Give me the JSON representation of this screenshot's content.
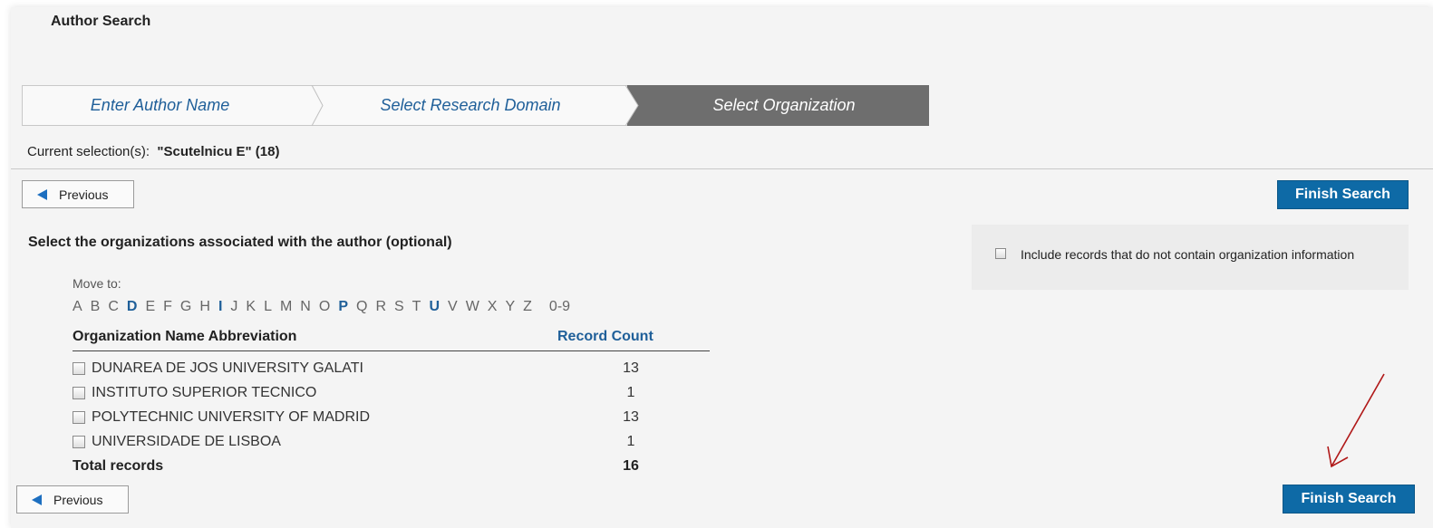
{
  "page": {
    "title": "Author Search"
  },
  "steps": [
    {
      "label": "Enter Author Name",
      "active": false
    },
    {
      "label": "Select Research Domain",
      "active": false
    },
    {
      "label": "Select Organization",
      "active": true
    }
  ],
  "selection": {
    "prefix": "Current selection(s):",
    "value": "\"Scutelnicu E\" (18)"
  },
  "buttons": {
    "previous": "Previous",
    "finish": "Finish Search"
  },
  "org_section": {
    "heading": "Select the organizations associated with the author (optional)",
    "include_label": "Include records that do not contain organization information",
    "include_checked": false,
    "move_to_label": "Move to:",
    "alphabet": [
      {
        "letter": "A",
        "active": false
      },
      {
        "letter": "B",
        "active": false
      },
      {
        "letter": "C",
        "active": false
      },
      {
        "letter": "D",
        "active": true
      },
      {
        "letter": "E",
        "active": false
      },
      {
        "letter": "F",
        "active": false
      },
      {
        "letter": "G",
        "active": false
      },
      {
        "letter": "H",
        "active": false
      },
      {
        "letter": "I",
        "active": true
      },
      {
        "letter": "J",
        "active": false
      },
      {
        "letter": "K",
        "active": false
      },
      {
        "letter": "L",
        "active": false
      },
      {
        "letter": "M",
        "active": false
      },
      {
        "letter": "N",
        "active": false
      },
      {
        "letter": "O",
        "active": false
      },
      {
        "letter": "P",
        "active": true
      },
      {
        "letter": "Q",
        "active": false
      },
      {
        "letter": "R",
        "active": false
      },
      {
        "letter": "S",
        "active": false
      },
      {
        "letter": "T",
        "active": false
      },
      {
        "letter": "U",
        "active": true
      },
      {
        "letter": "V",
        "active": false
      },
      {
        "letter": "W",
        "active": false
      },
      {
        "letter": "X",
        "active": false
      },
      {
        "letter": "Y",
        "active": false
      },
      {
        "letter": "Z",
        "active": false
      },
      {
        "letter": "0-9",
        "active": false
      }
    ]
  },
  "table": {
    "col_name": "Organization Name Abbreviation",
    "col_count": "Record Count",
    "rows": [
      {
        "name": "DUNAREA DE JOS UNIVERSITY GALATI",
        "count": "13",
        "checked": false
      },
      {
        "name": "INSTITUTO SUPERIOR TECNICO",
        "count": "1",
        "checked": false
      },
      {
        "name": "POLYTECHNIC UNIVERSITY OF MADRID",
        "count": "13",
        "checked": false
      },
      {
        "name": "UNIVERSIDADE DE LISBOA",
        "count": "1",
        "checked": false
      }
    ],
    "total_label": "Total records",
    "total_value": "16"
  },
  "colors": {
    "accent_blue": "#0e6aa6",
    "link_blue": "#1f5f99",
    "active_step": "#6e6e6e",
    "annotation_arrow": "#b01818"
  }
}
